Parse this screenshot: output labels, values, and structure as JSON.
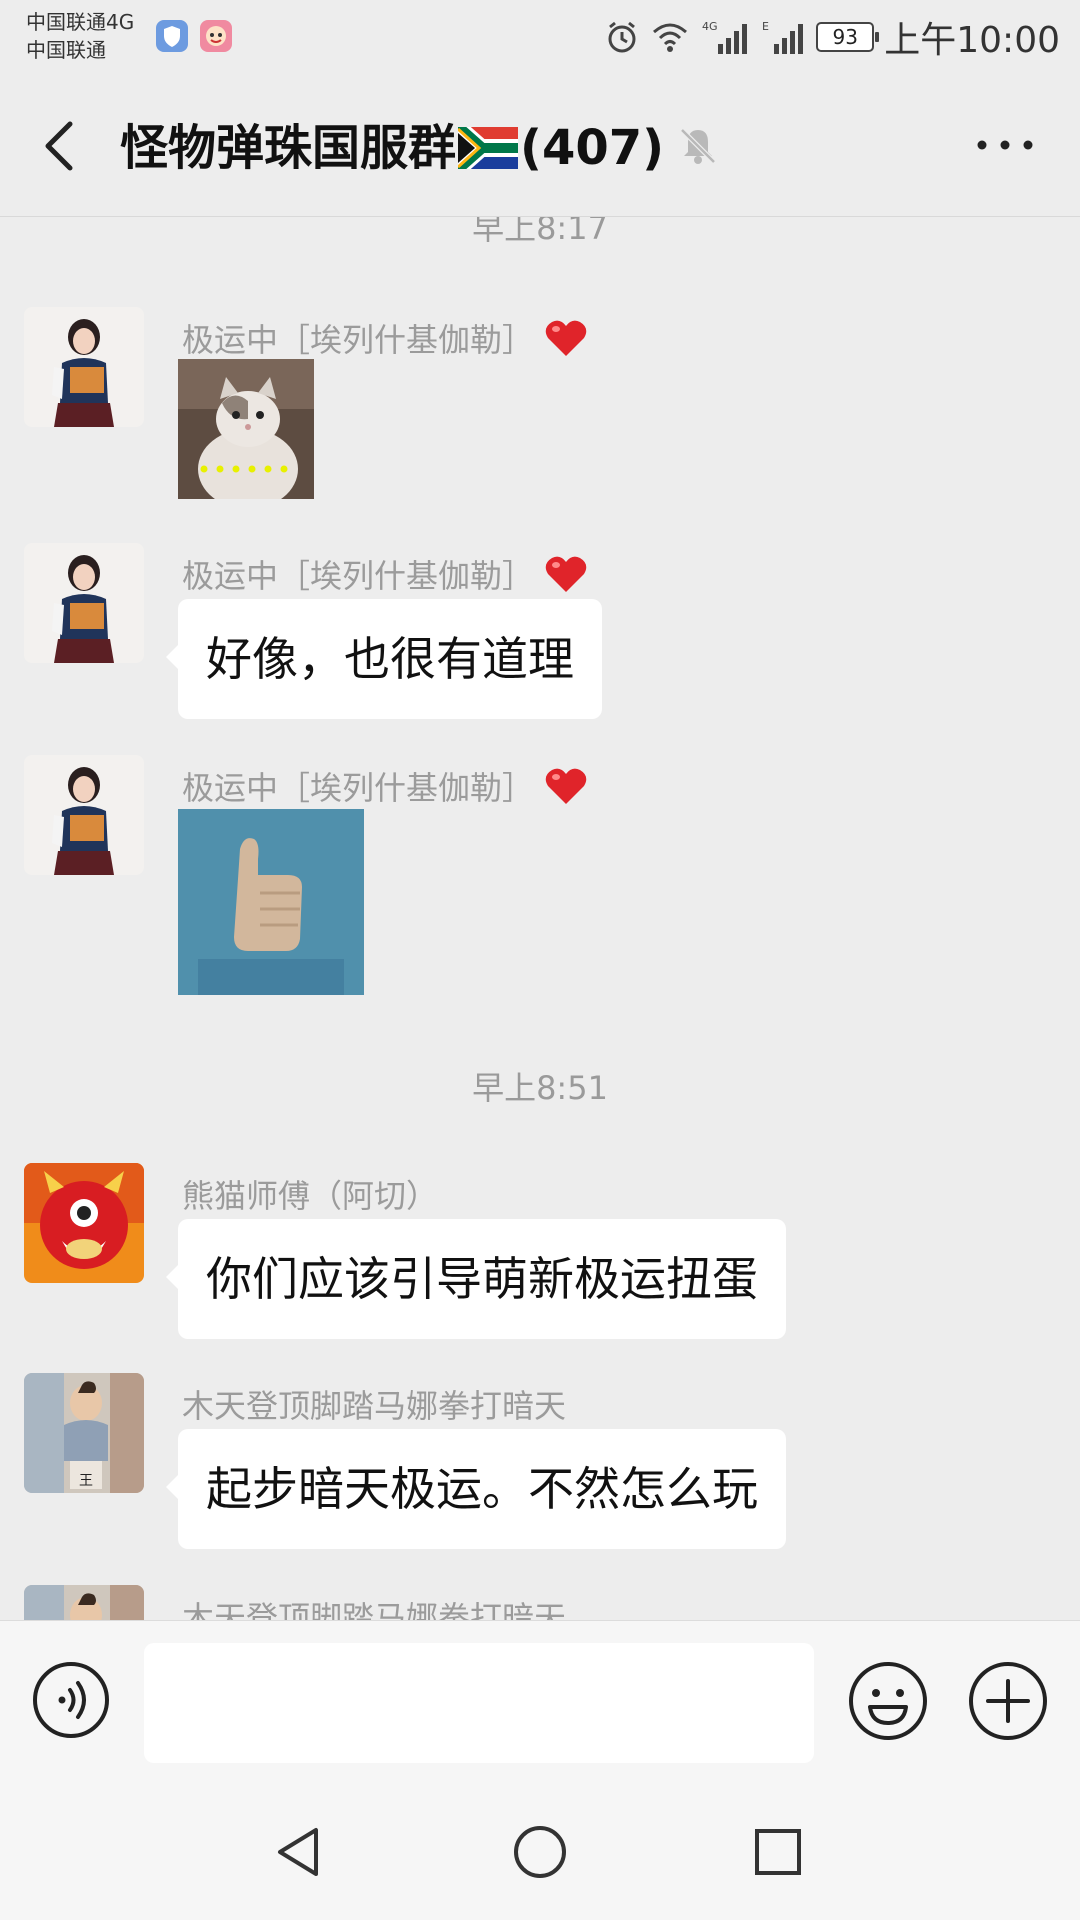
{
  "status_bar": {
    "carrier_line1": "中国联通4G",
    "carrier_line2": "中国联通",
    "battery": "93",
    "time": "上午10:00"
  },
  "header": {
    "title": "怪物弹珠国服群",
    "member_count": "(407)"
  },
  "timestamps": [
    "早上8:17",
    "早上8:51"
  ],
  "messages": [
    {
      "sender": "极运中［埃列什基伽勒］",
      "type": "image",
      "content": "cat sticker"
    },
    {
      "sender": "极运中［埃列什基伽勒］",
      "type": "text",
      "text": "好像，也很有道理"
    },
    {
      "sender": "极运中［埃列什基伽勒］",
      "type": "image",
      "content": "thumbs up sticker"
    },
    {
      "sender": "熊猫师傅（阿切）",
      "type": "text",
      "text": "你们应该引导萌新极运扭蛋"
    },
    {
      "sender": "木天登顶脚踏马娜拳打暗天",
      "type": "text",
      "text": "起步暗天极运。不然怎么玩"
    },
    {
      "sender": "木天登顶脚踏马娜拳打暗天",
      "type": "partial"
    }
  ],
  "input": {
    "value": "",
    "placeholder": ""
  },
  "icons": {
    "back": "chevron-left-icon",
    "mute": "bell-off-icon",
    "more": "more-horizontal-icon",
    "voice": "voice-icon",
    "emoji": "smiley-icon",
    "plus": "plus-circle-icon"
  },
  "colors": {
    "background": "#ededed",
    "bubble": "#ffffff",
    "sender_text": "#9b9b9b",
    "heart": "#e0242a"
  }
}
